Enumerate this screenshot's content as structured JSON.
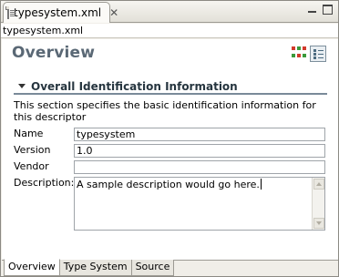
{
  "editor": {
    "tab_label": "typesystem.xml",
    "breadcrumb": "typesystem.xml"
  },
  "page": {
    "title": "Overview"
  },
  "section": {
    "title": "Overall Identification Information",
    "description": "This section specifies the basic identification information for this descriptor"
  },
  "fields": {
    "name_label": "Name",
    "name_value": "typesystem",
    "version_label": "Version",
    "version_value": "1.0",
    "vendor_label": "Vendor",
    "vendor_value": "",
    "description_label": "Description:",
    "description_value": "A sample description would go here."
  },
  "bottom_tabs": [
    "Overview",
    "Type System",
    "Source"
  ],
  "icons": {
    "file": "xml-file-icon",
    "close": "close-icon",
    "minimize": "minimize-icon",
    "maximize": "maximize-icon",
    "layout_grid": "grid-layout-icon",
    "layout_list": "list-layout-icon",
    "twisty": "twisty-expanded-icon"
  },
  "colors": {
    "title": "#5a6875",
    "section_rule": "#7a8a99",
    "grid_red": "#d23a2c",
    "grid_green": "#3a9a3a"
  }
}
